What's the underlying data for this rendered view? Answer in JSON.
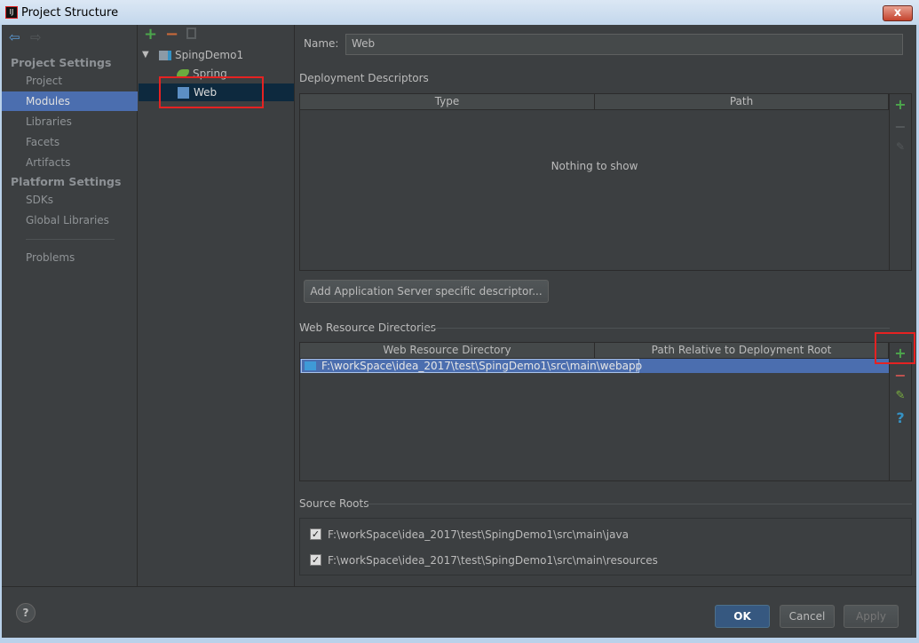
{
  "window": {
    "title": "Project Structure",
    "close": "x"
  },
  "sidebar": {
    "sections": [
      {
        "header": "Project Settings",
        "items": [
          "Project",
          "Modules",
          "Libraries",
          "Facets",
          "Artifacts"
        ]
      },
      {
        "header": "Platform Settings",
        "items": [
          "SDKs",
          "Global Libraries"
        ]
      }
    ],
    "problems": "Problems",
    "selected": "Modules"
  },
  "tree": {
    "root": "SpingDemo1",
    "children": [
      "Spring",
      "Web"
    ],
    "selected": "Web"
  },
  "name": {
    "label": "Name:",
    "value": "Web"
  },
  "deployment": {
    "title": "Deployment Descriptors",
    "columns": [
      "Type",
      "Path"
    ],
    "empty": "Nothing to show",
    "add_button": "Add Application Server specific descriptor..."
  },
  "web_resources": {
    "title": "Web Resource Directories",
    "columns": [
      "Web Resource Directory",
      "Path Relative to Deployment Root"
    ],
    "rows": [
      {
        "directory": "F:\\workSpace\\idea_2017\\test\\SpingDemo1\\src\\main\\webapp",
        "path": ""
      }
    ]
  },
  "source_roots": {
    "title": "Source Roots",
    "items": [
      {
        "checked": true,
        "path": "F:\\workSpace\\idea_2017\\test\\SpingDemo1\\src\\main\\java"
      },
      {
        "checked": true,
        "path": "F:\\workSpace\\idea_2017\\test\\SpingDemo1\\src\\main\\resources"
      }
    ]
  },
  "footer": {
    "help": "?",
    "ok": "OK",
    "cancel": "Cancel",
    "apply": "Apply"
  },
  "colors": {
    "selection": "#4b6eaf",
    "tree_selection": "#0d293e",
    "add": "#4ca64c",
    "remove": "#c75450",
    "highlight": "#e52222"
  }
}
